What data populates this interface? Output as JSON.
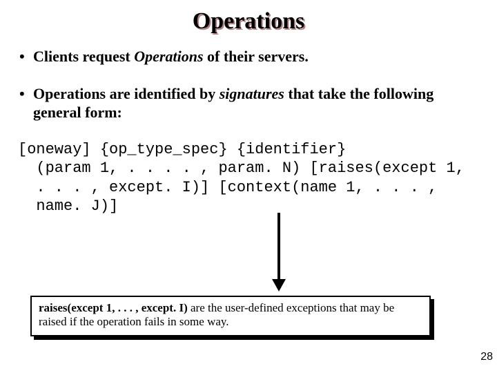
{
  "title": "Operations",
  "bullets": {
    "b1_pre": "Clients request ",
    "b1_em": "Operations",
    "b1_post": " of their servers.",
    "b2_pre": "Operations are identified by ",
    "b2_em": "signatures",
    "b2_post": " that take the following general form:"
  },
  "code": "[oneway] {op_type_spec} {identifier}\n  (param 1, . . . . , param. N) [raises(except 1,\n  . . . , except. I)] [context(name 1, . . . ,\n  name. J)]",
  "note": {
    "strong": "raises(except 1, . . . , except. I)",
    "rest": " are the user-defined exceptions that may be raised if the operation fails in some way."
  },
  "page_number": "28"
}
